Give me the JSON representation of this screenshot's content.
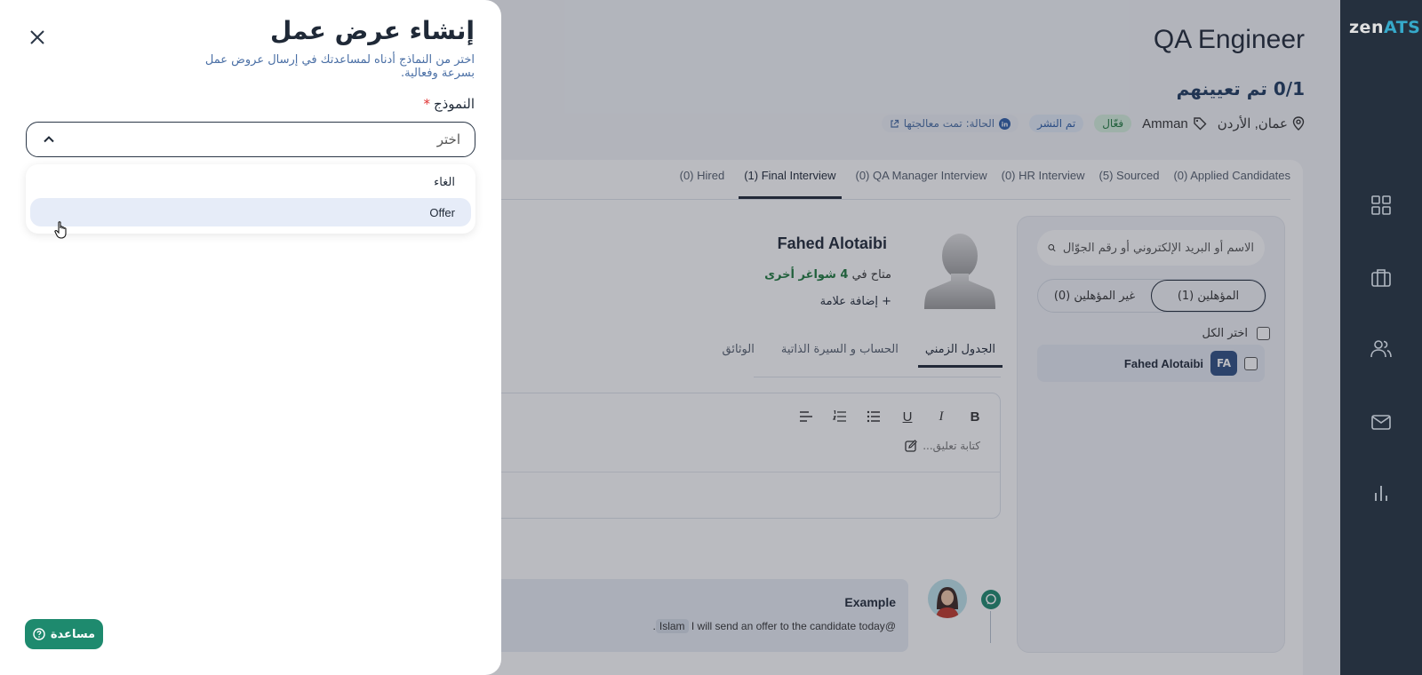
{
  "app": {
    "logo_main": "zen",
    "logo_accent": "ATS"
  },
  "nav": {
    "items": [
      "dashboard-icon",
      "jobs-icon",
      "candidates-icon",
      "mail-icon",
      "reports-icon"
    ]
  },
  "job": {
    "title": "QA Engineer",
    "assigned": "0/1 تم تعيينهم",
    "location": "عمان, الأردن",
    "tag": "Amman",
    "status_active": "فعّال",
    "status_published": "تم النشر",
    "linkedin_status": "الحالة: تمت معالجتها"
  },
  "stages": [
    {
      "label": "(0) Applied Candidates",
      "active": false
    },
    {
      "label": "(5) Sourced",
      "active": false
    },
    {
      "label": "(0) HR Interview",
      "active": false
    },
    {
      "label": "(0) QA Manager Interview",
      "active": false
    },
    {
      "label": "(1) Final Interview",
      "active": true
    },
    {
      "label": "(0) Hired",
      "active": false
    }
  ],
  "candidate_panel": {
    "search_placeholder": "الاسم أو البريد الإلكتروني أو رقم الجوّال",
    "qualified_label": "المؤهلين (1)",
    "unqualified_label": "غير المؤهلين (0)",
    "select_all_label": "اختر الكل",
    "candidates": [
      {
        "initials": "FA",
        "name": "Fahed Alotaibi"
      }
    ]
  },
  "candidate_detail": {
    "name": "Fahed Alotaibi",
    "availability_prefix": "متاح في",
    "availability_count": "4 شواغر أخرى",
    "add_tag_label": "+ إضافة علامة",
    "tabs": [
      {
        "label": "الجدول الزمني",
        "active": true
      },
      {
        "label": "الحساب و السيرة الذاتية",
        "active": false
      },
      {
        "label": "الوثائق",
        "active": false
      }
    ],
    "editor_toolbar": [
      "B",
      "I",
      "U",
      "bulleted-list",
      "numbered-list",
      "align-left"
    ],
    "comment_placeholder": "كتابة تعليق..."
  },
  "comment": {
    "author": "Example",
    "mention": "Islam",
    "text_prefix": "@",
    "text_body": " I will send an offer to the candidate today",
    "text_suffix": "."
  },
  "drawer": {
    "title": "إنشاء عرض عمل",
    "subtitle": "اختر من النماذج أدناه لمساعدتك في إرسال عروض عمل بسرعة وفعالية.",
    "field_label": "النموذج",
    "required_mark": "*",
    "select_value": "اختر",
    "options": [
      {
        "label": "الغاء",
        "hovered": false
      },
      {
        "label": "Offer",
        "hovered": true
      }
    ],
    "help_label": "مساعدة"
  },
  "colors": {
    "nav_bg": "#2b3747",
    "accent_teal": "#3ec1e6",
    "help_green": "#1e8a6e",
    "link_blue": "#4a6fa5"
  }
}
